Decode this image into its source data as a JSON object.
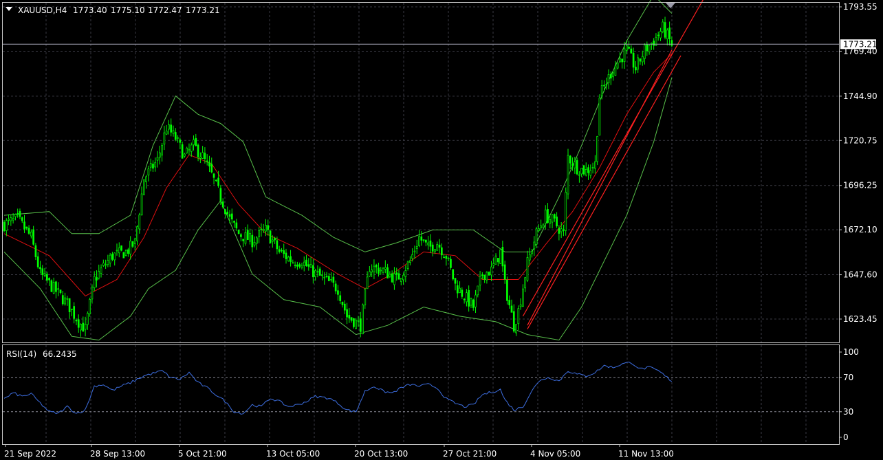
{
  "header": {
    "symbol": "XAUUSD,H4",
    "open": "1773.40",
    "high": "1775.10",
    "low": "1772.47",
    "close": "1773.21"
  },
  "rsi_header": {
    "label": "RSI(14)",
    "value": "66.2435"
  },
  "colors": {
    "background": "#000000",
    "grid": "#3a3a44",
    "candle": "#00ff00",
    "bollinger": "#58c04a",
    "moving_average": "#e01010",
    "channel": "#ff2020",
    "rsi_line": "#3d6ee0",
    "price_label_bg": "#ffffff",
    "text": "#ffffff"
  },
  "chart_data": [
    {
      "type": "candlestick",
      "symbol": "XAUUSD",
      "timeframe": "H4",
      "ylim": [
        1613,
        1797
      ],
      "y_ticks": [
        "1793.55",
        "1769.40",
        "1744.90",
        "1720.75",
        "1696.25",
        "1672.10",
        "1647.60",
        "1623.45"
      ],
      "current_price": "1773.21",
      "x_ticks": [
        "21 Sep 2022",
        "28 Sep 13:00",
        "5 Oct 21:00",
        "13 Oct 05:00",
        "20 Oct 13:00",
        "27 Oct 21:00",
        "4 Nov 05:00",
        "11 Nov 13:00"
      ],
      "close_path": [
        [
          0,
          1675
        ],
        [
          6,
          1678
        ],
        [
          12,
          1668
        ],
        [
          16,
          1648
        ],
        [
          22,
          1640
        ],
        [
          28,
          1632
        ],
        [
          33,
          1622
        ],
        [
          36,
          1618
        ],
        [
          40,
          1645
        ],
        [
          44,
          1652
        ],
        [
          48,
          1658
        ],
        [
          54,
          1660
        ],
        [
          58,
          1665
        ],
        [
          62,
          1700
        ],
        [
          68,
          1710
        ],
        [
          72,
          1728
        ],
        [
          76,
          1722
        ],
        [
          80,
          1712
        ],
        [
          84,
          1718
        ],
        [
          88,
          1712
        ],
        [
          92,
          1702
        ],
        [
          96,
          1690
        ],
        [
          100,
          1678
        ],
        [
          104,
          1670
        ],
        [
          110,
          1666
        ],
        [
          116,
          1672
        ],
        [
          122,
          1660
        ],
        [
          128,
          1655
        ],
        [
          132,
          1655
        ],
        [
          136,
          1650
        ],
        [
          142,
          1645
        ],
        [
          148,
          1640
        ],
        [
          152,
          1625
        ],
        [
          158,
          1620
        ],
        [
          162,
          1652
        ],
        [
          168,
          1650
        ],
        [
          174,
          1645
        ],
        [
          180,
          1655
        ],
        [
          184,
          1668
        ],
        [
          188,
          1662
        ],
        [
          192,
          1665
        ],
        [
          196,
          1658
        ],
        [
          200,
          1642
        ],
        [
          204,
          1636
        ],
        [
          208,
          1630
        ],
        [
          212,
          1648
        ],
        [
          216,
          1650
        ],
        [
          220,
          1660
        ],
        [
          222,
          1642
        ],
        [
          226,
          1620
        ],
        [
          228,
          1628
        ],
        [
          232,
          1654
        ],
        [
          236,
          1670
        ],
        [
          240,
          1680
        ],
        [
          244,
          1676
        ],
        [
          248,
          1670
        ],
        [
          250,
          1712
        ],
        [
          254,
          1706
        ],
        [
          258,
          1704
        ],
        [
          262,
          1708
        ],
        [
          264,
          1745
        ],
        [
          270,
          1760
        ],
        [
          276,
          1770
        ],
        [
          280,
          1760
        ],
        [
          284,
          1770
        ],
        [
          288,
          1775
        ],
        [
          292,
          1782
        ],
        [
          296,
          1773
        ]
      ],
      "moving_average": {
        "period": 20,
        "path": [
          [
            0,
            1670
          ],
          [
            20,
            1658
          ],
          [
            36,
            1636
          ],
          [
            50,
            1645
          ],
          [
            62,
            1668
          ],
          [
            72,
            1695
          ],
          [
            82,
            1713
          ],
          [
            92,
            1708
          ],
          [
            104,
            1686
          ],
          [
            116,
            1670
          ],
          [
            130,
            1662
          ],
          [
            148,
            1648
          ],
          [
            160,
            1640
          ],
          [
            172,
            1648
          ],
          [
            186,
            1660
          ],
          [
            200,
            1658
          ],
          [
            212,
            1645
          ],
          [
            228,
            1645
          ],
          [
            240,
            1664
          ],
          [
            252,
            1682
          ],
          [
            264,
            1706
          ],
          [
            276,
            1735
          ],
          [
            288,
            1758
          ],
          [
            296,
            1768
          ]
        ]
      },
      "bollinger_upper": [
        [
          0,
          1680
        ],
        [
          20,
          1682
        ],
        [
          30,
          1670
        ],
        [
          42,
          1670
        ],
        [
          56,
          1680
        ],
        [
          66,
          1718
        ],
        [
          76,
          1745
        ],
        [
          86,
          1735
        ],
        [
          96,
          1730
        ],
        [
          106,
          1720
        ],
        [
          116,
          1690
        ],
        [
          132,
          1680
        ],
        [
          146,
          1668
        ],
        [
          160,
          1660
        ],
        [
          174,
          1665
        ],
        [
          190,
          1672
        ],
        [
          208,
          1672
        ],
        [
          222,
          1660
        ],
        [
          234,
          1660
        ],
        [
          246,
          1690
        ],
        [
          256,
          1718
        ],
        [
          266,
          1748
        ],
        [
          276,
          1775
        ],
        [
          288,
          1800
        ],
        [
          296,
          1790
        ]
      ],
      "bollinger_lower": [
        [
          0,
          1660
        ],
        [
          16,
          1640
        ],
        [
          30,
          1614
        ],
        [
          42,
          1612
        ],
        [
          56,
          1625
        ],
        [
          64,
          1640
        ],
        [
          76,
          1650
        ],
        [
          86,
          1672
        ],
        [
          96,
          1688
        ],
        [
          110,
          1648
        ],
        [
          124,
          1634
        ],
        [
          140,
          1630
        ],
        [
          156,
          1615
        ],
        [
          170,
          1620
        ],
        [
          186,
          1630
        ],
        [
          202,
          1625
        ],
        [
          218,
          1622
        ],
        [
          232,
          1615
        ],
        [
          246,
          1612
        ],
        [
          256,
          1630
        ],
        [
          264,
          1650
        ],
        [
          276,
          1680
        ],
        [
          288,
          1720
        ],
        [
          296,
          1755
        ]
      ],
      "channel_lines": [
        [
          [
            230,
            1625
          ],
          [
            312,
            1802
          ]
        ],
        [
          [
            232,
            1620
          ],
          [
            296,
            1770
          ]
        ],
        [
          [
            232,
            1618
          ],
          [
            300,
            1767
          ]
        ]
      ]
    },
    {
      "type": "line",
      "indicator": "RSI(14)",
      "value": "66.2435",
      "ylim": [
        0,
        100
      ],
      "y_ticks": [
        "100",
        "70",
        "30",
        "0"
      ],
      "levels": [
        70,
        30
      ],
      "values": [
        [
          0,
          45
        ],
        [
          4,
          52
        ],
        [
          8,
          48
        ],
        [
          12,
          51
        ],
        [
          16,
          40
        ],
        [
          20,
          30
        ],
        [
          24,
          28
        ],
        [
          28,
          36
        ],
        [
          32,
          28
        ],
        [
          36,
          32
        ],
        [
          40,
          60
        ],
        [
          44,
          62
        ],
        [
          48,
          55
        ],
        [
          52,
          60
        ],
        [
          56,
          64
        ],
        [
          62,
          72
        ],
        [
          66,
          75
        ],
        [
          70,
          78
        ],
        [
          74,
          70
        ],
        [
          78,
          68
        ],
        [
          82,
          76
        ],
        [
          86,
          64
        ],
        [
          90,
          58
        ],
        [
          94,
          50
        ],
        [
          98,
          42
        ],
        [
          102,
          30
        ],
        [
          106,
          28
        ],
        [
          110,
          38
        ],
        [
          114,
          36
        ],
        [
          118,
          46
        ],
        [
          122,
          42
        ],
        [
          126,
          36
        ],
        [
          130,
          38
        ],
        [
          134,
          42
        ],
        [
          138,
          48
        ],
        [
          144,
          46
        ],
        [
          148,
          40
        ],
        [
          152,
          32
        ],
        [
          156,
          30
        ],
        [
          160,
          54
        ],
        [
          164,
          60
        ],
        [
          168,
          54
        ],
        [
          172,
          52
        ],
        [
          176,
          58
        ],
        [
          180,
          62
        ],
        [
          184,
          60
        ],
        [
          188,
          62
        ],
        [
          192,
          58
        ],
        [
          196,
          45
        ],
        [
          200,
          40
        ],
        [
          204,
          36
        ],
        [
          208,
          38
        ],
        [
          212,
          50
        ],
        [
          216,
          53
        ],
        [
          220,
          56
        ],
        [
          222,
          44
        ],
        [
          226,
          32
        ],
        [
          230,
          36
        ],
        [
          234,
          55
        ],
        [
          238,
          68
        ],
        [
          242,
          70
        ],
        [
          246,
          66
        ],
        [
          250,
          78
        ],
        [
          254,
          74
        ],
        [
          258,
          72
        ],
        [
          262,
          76
        ],
        [
          266,
          84
        ],
        [
          270,
          82
        ],
        [
          274,
          86
        ],
        [
          278,
          88
        ],
        [
          282,
          80
        ],
        [
          286,
          82
        ],
        [
          290,
          78
        ],
        [
          294,
          70
        ],
        [
          296,
          66
        ]
      ]
    }
  ]
}
